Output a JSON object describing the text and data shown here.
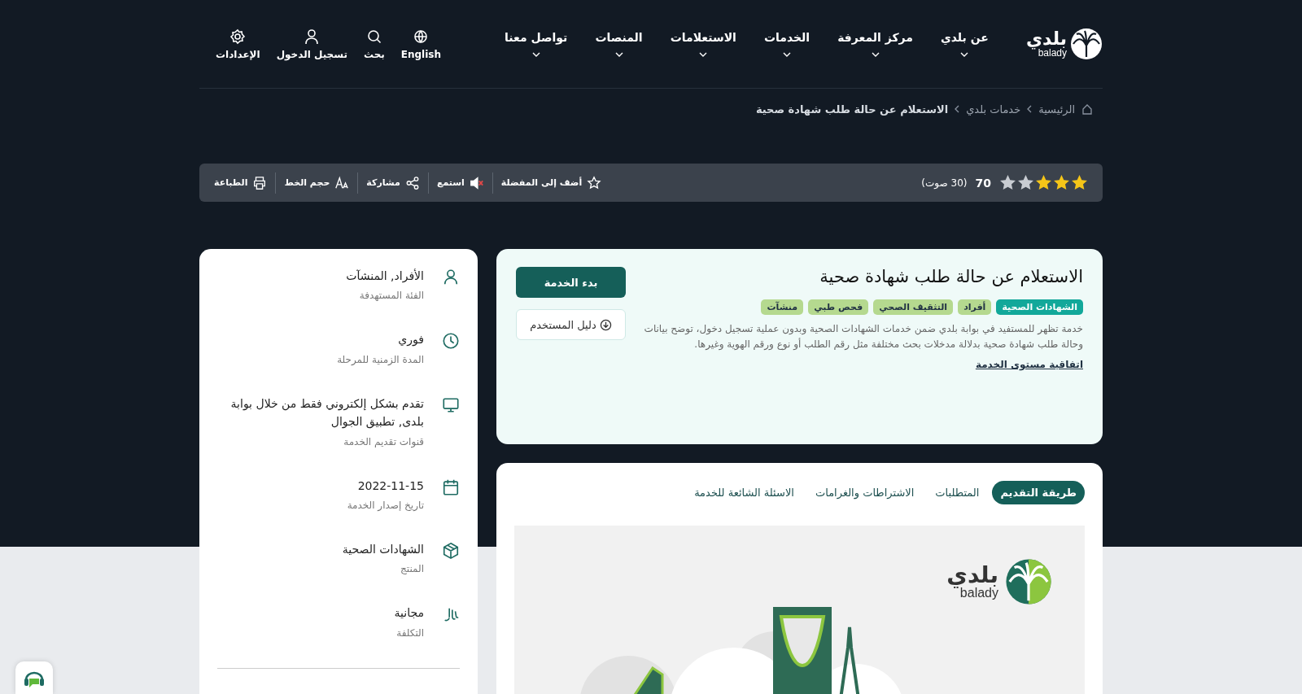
{
  "header": {
    "logo": {
      "arabic": "بلدي",
      "latin": "balady"
    },
    "nav": [
      {
        "label": "عن بلدي"
      },
      {
        "label": "مركز المعرفة"
      },
      {
        "label": "الخدمات"
      },
      {
        "label": "الاستعلامات"
      },
      {
        "label": "المنصات"
      },
      {
        "label": "تواصل معنا"
      }
    ],
    "utilities": [
      {
        "kind": "globe",
        "label": "English"
      },
      {
        "kind": "search",
        "label": "بحث"
      },
      {
        "kind": "user",
        "label": "تسجيل الدخول"
      },
      {
        "kind": "gear",
        "label": "الإعدادات"
      }
    ]
  },
  "breadcrumb": [
    "الرئيسية",
    "خدمات بلدي",
    "الاستعلام عن حالة طلب شهادة صحية"
  ],
  "toolbar": {
    "stars": 3,
    "rating": "70",
    "votes": "(30 صوت)",
    "actions": [
      {
        "kind": "star",
        "label": "أضف إلى المفضلة"
      },
      {
        "kind": "speaker",
        "label": "استمع"
      },
      {
        "kind": "share",
        "label": "مشاركة"
      },
      {
        "kind": "font",
        "label": "حجم الخط"
      },
      {
        "kind": "print",
        "label": "الطباعة"
      }
    ]
  },
  "service": {
    "title": "الاستعلام عن حالة طلب شهادة صحية",
    "tags": [
      {
        "label": "الشهادات الصحية",
        "color": "#12a89a"
      },
      {
        "label": "أفراد",
        "color": "#b5d98f"
      },
      {
        "label": "التثقيف الصحي",
        "color": "#b5d98f"
      },
      {
        "label": "فحص طبي",
        "color": "#b5d98f"
      },
      {
        "label": "منشآت",
        "color": "#b5d98f"
      }
    ],
    "description": "خدمة تظهر للمستفيد في بوابة بلدي ضمن خدمات الشهادات الصحية وبدون عملية تسجيل دخول، توضح بيانات وحالة طلب شهادة صحية بدلالة مدخلات بحث مختلفة مثل رقم الطلب أو نوع ورقم الهوية وغيرها.",
    "sla_link": "اتفاقية مستوى الخدمة",
    "start_button": "بدء الخدمة",
    "guide_button": "دليل المستخدم"
  },
  "details": [
    {
      "kind": "user",
      "value": "الأفراد, المنشآت",
      "label": "الفئة المستهدفة"
    },
    {
      "kind": "clock",
      "value": "فوري",
      "label": "المدة الزمنية للمرحلة"
    },
    {
      "kind": "monitor",
      "value": "تقدم بشكل إلكتروني فقط من خلال بوابة بلدى, تطبيق الجوال",
      "label": "قنوات تقديم الخدمة"
    },
    {
      "kind": "calendar",
      "value": "2022-11-15",
      "label": "تاريخ إصدار الخدمة"
    },
    {
      "kind": "box",
      "value": "الشهادات الصحية",
      "label": "المنتج"
    },
    {
      "kind": "riyal",
      "value": "مجانية",
      "label": "التكلفة"
    }
  ],
  "tabs": [
    {
      "label": "طريقة التقديم",
      "selected": true
    },
    {
      "label": "المتطلبات",
      "selected": false
    },
    {
      "label": "الاشتراطات والغرامات",
      "selected": false
    },
    {
      "label": "الاسئلة الشائعة للخدمة",
      "selected": false
    }
  ],
  "illustration": {
    "logo": {
      "arabic": "بلدي",
      "latin": "balady"
    }
  }
}
